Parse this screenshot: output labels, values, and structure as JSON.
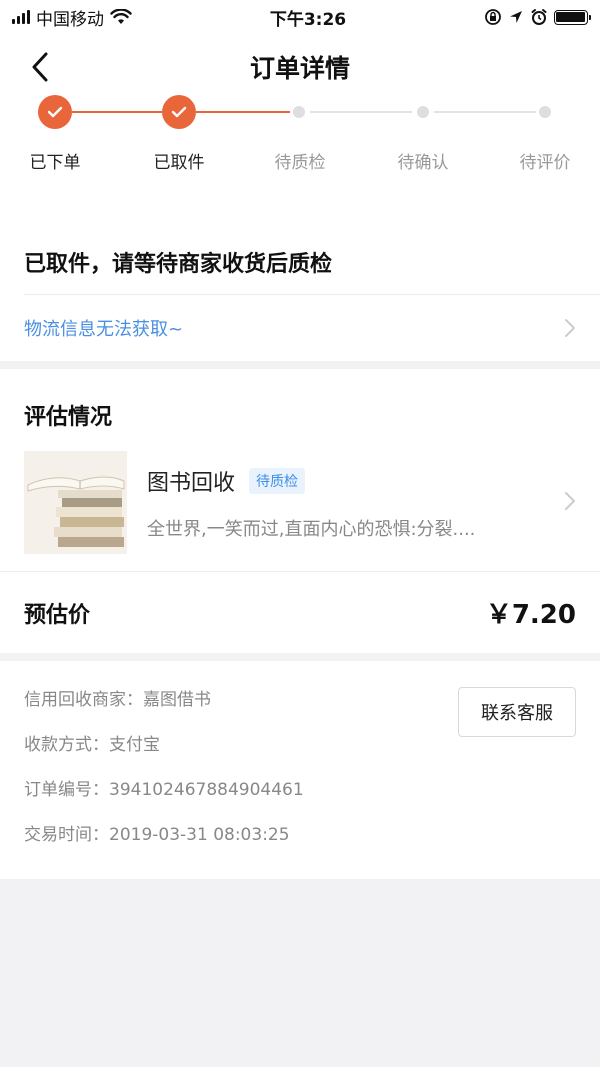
{
  "status_bar": {
    "carrier": "中国移动",
    "time": "下午3:26"
  },
  "nav": {
    "title": "订单详情"
  },
  "progress": {
    "steps": [
      {
        "label": "已下单",
        "done": true
      },
      {
        "label": "已取件",
        "done": true
      },
      {
        "label": "待质检",
        "done": false
      },
      {
        "label": "待确认",
        "done": false
      },
      {
        "label": "待评价",
        "done": false
      }
    ],
    "accent": "#e9663a"
  },
  "status": {
    "message": "已取件，请等待商家收货后质检",
    "logistics": "物流信息无法获取~"
  },
  "assessment": {
    "title": "评估情况",
    "item": {
      "name": "图书回收",
      "tag": "待质检",
      "desc": "全世界,一笑而过,直面内心的恐惧:分裂...."
    },
    "price_label": "预估价",
    "price_value": "￥7.20"
  },
  "info": {
    "merchant": "信用回收商家：嘉图借书",
    "payment": "收款方式：支付宝",
    "order_no": "订单编号：394102467884904461",
    "trade_time": "交易时间：2019-03-31 08:03:25",
    "contact_label": "联系客服"
  }
}
